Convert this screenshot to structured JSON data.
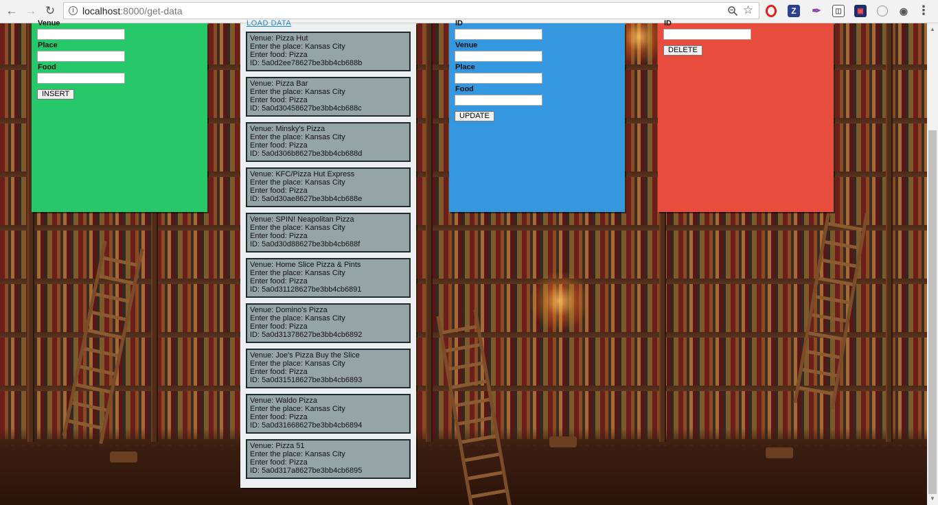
{
  "browser": {
    "url_host": "localhost",
    "url_rest": ":8000/get-data",
    "extensions": {
      "z_label": "Z"
    }
  },
  "insert_form": {
    "venue_label": "Venue",
    "place_label": "Place",
    "food_label": "Food",
    "insert_button": "INSERT",
    "color": "#27c86a"
  },
  "data_panel": {
    "load_link": "LOAD DATA",
    "field_prefixes": {
      "venue": "Venue: ",
      "place": "Enter the place: ",
      "food": "Enter food: ",
      "id": "ID: "
    },
    "records": [
      {
        "venue": "Pizza Hut",
        "place": "Kansas City",
        "food": "Pizza",
        "id": "5a0d2ee78627be3bb4cb688b"
      },
      {
        "venue": "Pizza Bar",
        "place": "Kansas City",
        "food": "Pizza",
        "id": "5a0d30458627be3bb4cb688c"
      },
      {
        "venue": "Minsky's Pizza",
        "place": "Kansas City",
        "food": "Pizza",
        "id": "5a0d306b8627be3bb4cb688d"
      },
      {
        "venue": "KFC/Pizza Hut Express",
        "place": "Kansas City",
        "food": "Pizza",
        "id": "5a0d30ae8627be3bb4cb688e"
      },
      {
        "venue": "SPIN! Neapolitan Pizza",
        "place": "Kansas City",
        "food": "Pizza",
        "id": "5a0d30d88627be3bb4cb688f"
      },
      {
        "venue": "Home Slice Pizza & Pints",
        "place": "Kansas City",
        "food": "Pizza",
        "id": "5a0d31128627be3bb4cb6891"
      },
      {
        "venue": "Domino's Pizza",
        "place": "Kansas City",
        "food": "Pizza",
        "id": "5a0d31378627be3bb4cb6892"
      },
      {
        "venue": "Joe's Pizza Buy the Slice",
        "place": "Kansas City",
        "food": "Pizza",
        "id": "5a0d31518627be3bb4cb6893"
      },
      {
        "venue": "Waldo Pizza",
        "place": "Kansas City",
        "food": "Pizza",
        "id": "5a0d31668627be3bb4cb6894"
      },
      {
        "venue": "Pizza 51",
        "place": "Kansas City",
        "food": "Pizza",
        "id": "5a0d317a8627be3bb4cb6895"
      }
    ]
  },
  "update_form": {
    "id_label": "ID",
    "venue_label": "Venue",
    "place_label": "Place",
    "food_label": "Food",
    "update_button": "UPDATE",
    "color": "#3597dd"
  },
  "delete_form": {
    "id_label": "ID",
    "delete_button": "DELETE",
    "color": "#e74c3c"
  }
}
